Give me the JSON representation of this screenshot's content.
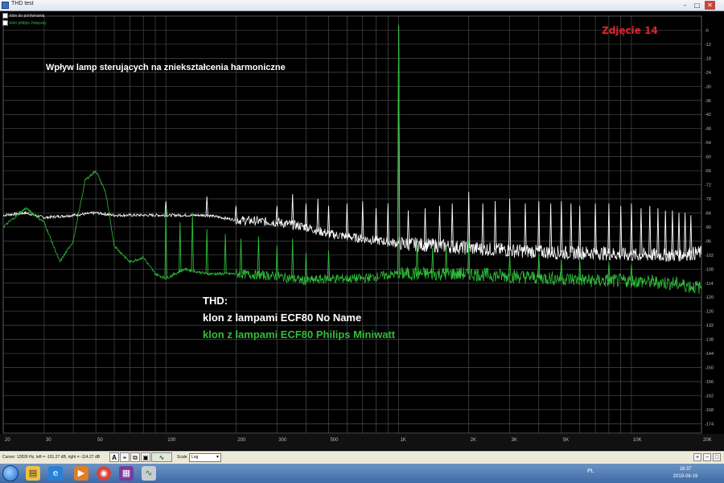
{
  "window": {
    "title": "THD test",
    "minimize_glyph": "–",
    "maximize_glyph": "□",
    "close_glyph": "✕"
  },
  "legend": {
    "items": [
      {
        "label": "klon do porównania",
        "color": "#ffffff"
      },
      {
        "label": "klon philips 2xlepszy",
        "color": "#3cb44b"
      }
    ]
  },
  "annotations": {
    "subtitle": "Wpływ lamp sterujących na zniekształcenia harmoniczne",
    "photo_label": "Zdjęcie 14",
    "thd_heading": "THD:",
    "series_white_label": "klon z lampami ECF80 No Name",
    "series_green_label": "klon z lampami ECF80 Philips Miniwatt"
  },
  "status": {
    "cursor_text": "Cursor: 12826 Hz, left = -101.27 dB, right = -114.27 dB",
    "scale_label": "Scale",
    "scale_value": "Log"
  },
  "taskbar": {
    "time": "16:37",
    "date": "2019-08-19",
    "tray_text": "PL"
  },
  "colors": {
    "background": "#000000",
    "grid": "#4a4a4a",
    "series_white": "#ffffff",
    "series_green": "#2fbf3a",
    "photo_label": "#e8212a"
  },
  "chart_data": {
    "type": "line",
    "xscale": "log",
    "xlim": [
      20,
      20000
    ],
    "ylim": [
      -178,
      0
    ],
    "grid": true,
    "x_ticks": [
      {
        "v": 20,
        "label": "20"
      },
      {
        "v": 30,
        "label": "30"
      },
      {
        "v": 50,
        "label": "50"
      },
      {
        "v": 100,
        "label": "100"
      },
      {
        "v": 200,
        "label": "200"
      },
      {
        "v": 300,
        "label": "300"
      },
      {
        "v": 500,
        "label": "500"
      },
      {
        "v": 1000,
        "label": "1K"
      },
      {
        "v": 2000,
        "label": "2K"
      },
      {
        "v": 3000,
        "label": "3K"
      },
      {
        "v": 5000,
        "label": "5K"
      },
      {
        "v": 10000,
        "label": "10K"
      },
      {
        "v": 20000,
        "label": "20K"
      }
    ],
    "y_ticks": [
      -6,
      -12,
      -18,
      -24,
      -30,
      -36,
      -42,
      -48,
      -54,
      -60,
      -66,
      -72,
      -78,
      -84,
      -90,
      -96,
      -102,
      -108,
      -114,
      -120,
      -126,
      -132,
      -138,
      -144,
      -150,
      -156,
      -162,
      -168,
      -174
    ],
    "series": [
      {
        "color": "#ffffff",
        "points": [
          [
            20,
            -85
          ],
          [
            25,
            -84
          ],
          [
            30,
            -86
          ],
          [
            40,
            -85
          ],
          [
            50,
            -84
          ],
          [
            60,
            -85
          ],
          [
            80,
            -85
          ],
          [
            100,
            -85
          ],
          [
            150,
            -85
          ],
          [
            200,
            -87
          ],
          [
            300,
            -88
          ],
          [
            400,
            -90
          ],
          [
            500,
            -93
          ],
          [
            700,
            -95
          ],
          [
            1000,
            -97
          ],
          [
            1500,
            -98
          ],
          [
            2000,
            -99
          ],
          [
            3000,
            -100
          ],
          [
            5000,
            -101
          ],
          [
            7000,
            -101
          ],
          [
            10000,
            -102
          ],
          [
            15000,
            -102
          ],
          [
            20000,
            -101
          ]
        ],
        "spikes": [
          [
            100,
            -79
          ],
          [
            150,
            -77
          ],
          [
            200,
            -81
          ],
          [
            300,
            -81
          ],
          [
            350,
            -76
          ],
          [
            400,
            -80
          ],
          [
            450,
            -78
          ],
          [
            500,
            -81
          ],
          [
            600,
            -80
          ],
          [
            700,
            -79
          ],
          [
            800,
            -82
          ],
          [
            900,
            -80
          ],
          [
            1000,
            -4
          ],
          [
            1100,
            -83
          ],
          [
            1300,
            -82
          ],
          [
            1500,
            -81
          ],
          [
            1700,
            -80
          ],
          [
            2000,
            -75
          ],
          [
            2300,
            -80
          ],
          [
            2600,
            -79
          ],
          [
            3000,
            -78
          ],
          [
            3500,
            -80
          ],
          [
            4000,
            -79
          ],
          [
            4500,
            -80
          ],
          [
            5000,
            -79
          ],
          [
            5500,
            -80
          ],
          [
            6000,
            -81
          ],
          [
            7000,
            -80
          ],
          [
            8000,
            -80
          ],
          [
            9000,
            -81
          ],
          [
            10000,
            -80
          ],
          [
            11000,
            -82
          ],
          [
            12000,
            -81
          ],
          [
            13000,
            -82
          ],
          [
            14000,
            -83
          ],
          [
            15000,
            -83
          ],
          [
            16000,
            -84
          ],
          [
            17000,
            -84
          ],
          [
            18000,
            -85
          ]
        ]
      },
      {
        "color": "#2fbf3a",
        "points": [
          [
            20,
            -90
          ],
          [
            25,
            -82
          ],
          [
            30,
            -88
          ],
          [
            35,
            -105
          ],
          [
            40,
            -96
          ],
          [
            45,
            -70
          ],
          [
            50,
            -66
          ],
          [
            55,
            -75
          ],
          [
            60,
            -98
          ],
          [
            70,
            -105
          ],
          [
            80,
            -103
          ],
          [
            90,
            -110
          ],
          [
            100,
            -112
          ],
          [
            120,
            -108
          ],
          [
            150,
            -110
          ],
          [
            200,
            -110
          ],
          [
            300,
            -111
          ],
          [
            400,
            -113
          ],
          [
            500,
            -112
          ],
          [
            700,
            -112
          ],
          [
            1000,
            -110
          ],
          [
            1500,
            -110
          ],
          [
            2000,
            -110
          ],
          [
            3000,
            -111
          ],
          [
            5000,
            -112
          ],
          [
            7000,
            -113
          ],
          [
            10000,
            -113
          ],
          [
            15000,
            -114
          ],
          [
            20000,
            -116
          ]
        ],
        "spikes": [
          [
            100,
            -82
          ],
          [
            115,
            -88
          ],
          [
            130,
            -84
          ],
          [
            150,
            -91
          ],
          [
            180,
            -93
          ],
          [
            210,
            -95
          ],
          [
            250,
            -94
          ],
          [
            300,
            -98
          ],
          [
            350,
            -95
          ],
          [
            400,
            -101
          ],
          [
            500,
            -100
          ],
          [
            1000,
            -4
          ],
          [
            1200,
            -97
          ],
          [
            1400,
            -99
          ],
          [
            1600,
            -98
          ],
          [
            2000,
            -96
          ],
          [
            3000,
            -102
          ],
          [
            4000,
            -101
          ],
          [
            5000,
            -104
          ],
          [
            6000,
            -104
          ],
          [
            8000,
            -105
          ],
          [
            10000,
            -106
          ]
        ]
      }
    ]
  }
}
